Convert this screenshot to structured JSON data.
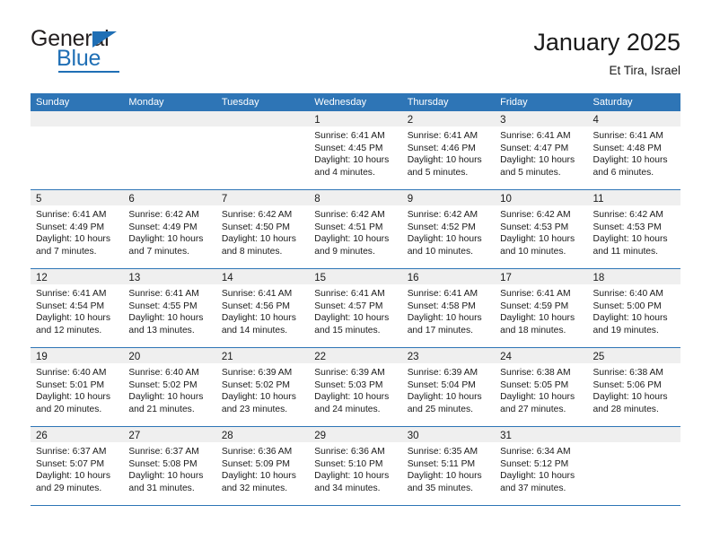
{
  "brand": {
    "name_top": "General",
    "name_bottom": "Blue",
    "accent_color": "#1f6fb5"
  },
  "header": {
    "title": "January 2025",
    "subtitle": "Et Tira, Israel"
  },
  "theme": {
    "header_blue": "#2e75b6",
    "daynum_band": "#efefef",
    "text": "#1a1a1a"
  },
  "weekdays": [
    "Sunday",
    "Monday",
    "Tuesday",
    "Wednesday",
    "Thursday",
    "Friday",
    "Saturday"
  ],
  "labels": {
    "sunrise_prefix": "Sunrise:",
    "sunset_prefix": "Sunset:",
    "daylight_prefix": "Daylight:"
  },
  "weeks": [
    [
      {
        "day": "",
        "empty": true,
        "lines": []
      },
      {
        "day": "",
        "empty": true,
        "lines": []
      },
      {
        "day": "",
        "empty": true,
        "lines": []
      },
      {
        "day": "1",
        "empty": false,
        "lines": [
          "Sunrise: 6:41 AM",
          "Sunset: 4:45 PM",
          "Daylight: 10 hours",
          "and 4 minutes."
        ]
      },
      {
        "day": "2",
        "empty": false,
        "lines": [
          "Sunrise: 6:41 AM",
          "Sunset: 4:46 PM",
          "Daylight: 10 hours",
          "and 5 minutes."
        ]
      },
      {
        "day": "3",
        "empty": false,
        "lines": [
          "Sunrise: 6:41 AM",
          "Sunset: 4:47 PM",
          "Daylight: 10 hours",
          "and 5 minutes."
        ]
      },
      {
        "day": "4",
        "empty": false,
        "lines": [
          "Sunrise: 6:41 AM",
          "Sunset: 4:48 PM",
          "Daylight: 10 hours",
          "and 6 minutes."
        ]
      }
    ],
    [
      {
        "day": "5",
        "empty": false,
        "lines": [
          "Sunrise: 6:41 AM",
          "Sunset: 4:49 PM",
          "Daylight: 10 hours",
          "and 7 minutes."
        ]
      },
      {
        "day": "6",
        "empty": false,
        "lines": [
          "Sunrise: 6:42 AM",
          "Sunset: 4:49 PM",
          "Daylight: 10 hours",
          "and 7 minutes."
        ]
      },
      {
        "day": "7",
        "empty": false,
        "lines": [
          "Sunrise: 6:42 AM",
          "Sunset: 4:50 PM",
          "Daylight: 10 hours",
          "and 8 minutes."
        ]
      },
      {
        "day": "8",
        "empty": false,
        "lines": [
          "Sunrise: 6:42 AM",
          "Sunset: 4:51 PM",
          "Daylight: 10 hours",
          "and 9 minutes."
        ]
      },
      {
        "day": "9",
        "empty": false,
        "lines": [
          "Sunrise: 6:42 AM",
          "Sunset: 4:52 PM",
          "Daylight: 10 hours",
          "and 10 minutes."
        ]
      },
      {
        "day": "10",
        "empty": false,
        "lines": [
          "Sunrise: 6:42 AM",
          "Sunset: 4:53 PM",
          "Daylight: 10 hours",
          "and 10 minutes."
        ]
      },
      {
        "day": "11",
        "empty": false,
        "lines": [
          "Sunrise: 6:42 AM",
          "Sunset: 4:53 PM",
          "Daylight: 10 hours",
          "and 11 minutes."
        ]
      }
    ],
    [
      {
        "day": "12",
        "empty": false,
        "lines": [
          "Sunrise: 6:41 AM",
          "Sunset: 4:54 PM",
          "Daylight: 10 hours",
          "and 12 minutes."
        ]
      },
      {
        "day": "13",
        "empty": false,
        "lines": [
          "Sunrise: 6:41 AM",
          "Sunset: 4:55 PM",
          "Daylight: 10 hours",
          "and 13 minutes."
        ]
      },
      {
        "day": "14",
        "empty": false,
        "lines": [
          "Sunrise: 6:41 AM",
          "Sunset: 4:56 PM",
          "Daylight: 10 hours",
          "and 14 minutes."
        ]
      },
      {
        "day": "15",
        "empty": false,
        "lines": [
          "Sunrise: 6:41 AM",
          "Sunset: 4:57 PM",
          "Daylight: 10 hours",
          "and 15 minutes."
        ]
      },
      {
        "day": "16",
        "empty": false,
        "lines": [
          "Sunrise: 6:41 AM",
          "Sunset: 4:58 PM",
          "Daylight: 10 hours",
          "and 17 minutes."
        ]
      },
      {
        "day": "17",
        "empty": false,
        "lines": [
          "Sunrise: 6:41 AM",
          "Sunset: 4:59 PM",
          "Daylight: 10 hours",
          "and 18 minutes."
        ]
      },
      {
        "day": "18",
        "empty": false,
        "lines": [
          "Sunrise: 6:40 AM",
          "Sunset: 5:00 PM",
          "Daylight: 10 hours",
          "and 19 minutes."
        ]
      }
    ],
    [
      {
        "day": "19",
        "empty": false,
        "lines": [
          "Sunrise: 6:40 AM",
          "Sunset: 5:01 PM",
          "Daylight: 10 hours",
          "and 20 minutes."
        ]
      },
      {
        "day": "20",
        "empty": false,
        "lines": [
          "Sunrise: 6:40 AM",
          "Sunset: 5:02 PM",
          "Daylight: 10 hours",
          "and 21 minutes."
        ]
      },
      {
        "day": "21",
        "empty": false,
        "lines": [
          "Sunrise: 6:39 AM",
          "Sunset: 5:02 PM",
          "Daylight: 10 hours",
          "and 23 minutes."
        ]
      },
      {
        "day": "22",
        "empty": false,
        "lines": [
          "Sunrise: 6:39 AM",
          "Sunset: 5:03 PM",
          "Daylight: 10 hours",
          "and 24 minutes."
        ]
      },
      {
        "day": "23",
        "empty": false,
        "lines": [
          "Sunrise: 6:39 AM",
          "Sunset: 5:04 PM",
          "Daylight: 10 hours",
          "and 25 minutes."
        ]
      },
      {
        "day": "24",
        "empty": false,
        "lines": [
          "Sunrise: 6:38 AM",
          "Sunset: 5:05 PM",
          "Daylight: 10 hours",
          "and 27 minutes."
        ]
      },
      {
        "day": "25",
        "empty": false,
        "lines": [
          "Sunrise: 6:38 AM",
          "Sunset: 5:06 PM",
          "Daylight: 10 hours",
          "and 28 minutes."
        ]
      }
    ],
    [
      {
        "day": "26",
        "empty": false,
        "lines": [
          "Sunrise: 6:37 AM",
          "Sunset: 5:07 PM",
          "Daylight: 10 hours",
          "and 29 minutes."
        ]
      },
      {
        "day": "27",
        "empty": false,
        "lines": [
          "Sunrise: 6:37 AM",
          "Sunset: 5:08 PM",
          "Daylight: 10 hours",
          "and 31 minutes."
        ]
      },
      {
        "day": "28",
        "empty": false,
        "lines": [
          "Sunrise: 6:36 AM",
          "Sunset: 5:09 PM",
          "Daylight: 10 hours",
          "and 32 minutes."
        ]
      },
      {
        "day": "29",
        "empty": false,
        "lines": [
          "Sunrise: 6:36 AM",
          "Sunset: 5:10 PM",
          "Daylight: 10 hours",
          "and 34 minutes."
        ]
      },
      {
        "day": "30",
        "empty": false,
        "lines": [
          "Sunrise: 6:35 AM",
          "Sunset: 5:11 PM",
          "Daylight: 10 hours",
          "and 35 minutes."
        ]
      },
      {
        "day": "31",
        "empty": false,
        "lines": [
          "Sunrise: 6:34 AM",
          "Sunset: 5:12 PM",
          "Daylight: 10 hours",
          "and 37 minutes."
        ]
      },
      {
        "day": "",
        "empty": true,
        "lines": []
      }
    ]
  ]
}
